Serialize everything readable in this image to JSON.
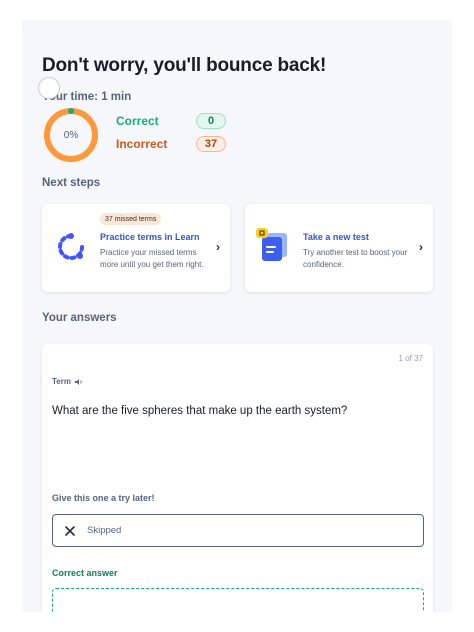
{
  "header": {
    "headline": "Don't worry, you'll bounce back!",
    "time_label": "Your time: 1 min"
  },
  "results": {
    "percent_label": "0%",
    "percent_value": 0,
    "correct_label": "Correct",
    "correct_count": "0",
    "incorrect_label": "Incorrect",
    "incorrect_count": "37"
  },
  "next_steps": {
    "title": "Next steps",
    "cards": [
      {
        "badge": "37 missed terms",
        "title": "Practice terms in Learn",
        "description": "Practice your missed terms more until you get them right.",
        "icon": "learn-icon"
      },
      {
        "title": "Take a new test",
        "description": "Try another test to boost your confidence.",
        "icon": "test-document-icon"
      }
    ]
  },
  "answers": {
    "title": "Your answers",
    "counter": "1 of 37",
    "term_label": "Term",
    "question": "What are the five spheres that make up the earth system?",
    "try_later_label": "Give this one a try later!",
    "skipped_text": "Skipped",
    "correct_answer_label": "Correct answer"
  },
  "colors": {
    "correct": "#18ae79",
    "incorrect": "#ff983a",
    "link": "#3056d3"
  }
}
